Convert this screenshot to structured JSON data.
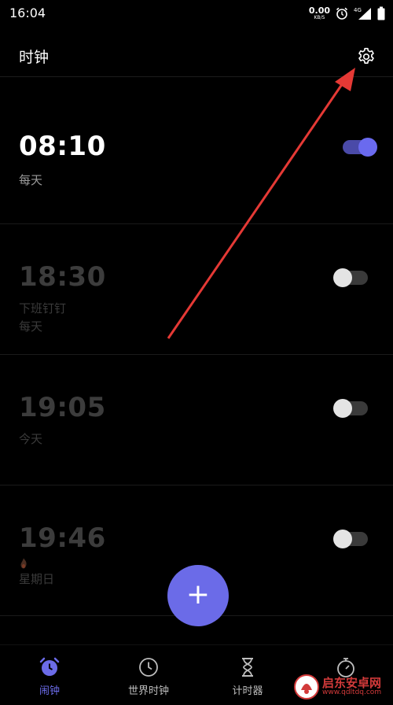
{
  "status_bar": {
    "time": "16:04",
    "net_speed": "0.00",
    "net_unit": "KB/S",
    "network": "4G",
    "icons": [
      "alarm-clock-icon",
      "signal-icon",
      "battery-icon"
    ]
  },
  "header": {
    "title": "时钟",
    "settings_icon": "gear-icon"
  },
  "alarms": [
    {
      "time": "08:10",
      "label": "",
      "repeat": "每天",
      "enabled": true
    },
    {
      "time": "18:30",
      "label": "下班钉钉",
      "repeat": "每天",
      "enabled": false
    },
    {
      "time": "19:05",
      "label": "",
      "repeat": "今天",
      "enabled": false
    },
    {
      "time": "19:46",
      "label": "",
      "repeat": "星期日",
      "enabled": false
    }
  ],
  "fab": {
    "label": "+"
  },
  "bottom_nav": [
    {
      "label": "闹钟",
      "icon": "alarm-clock-icon",
      "active": true
    },
    {
      "label": "世界时钟",
      "icon": "clock-icon",
      "active": false
    },
    {
      "label": "计时器",
      "icon": "hourglass-icon",
      "active": false
    },
    {
      "label": "",
      "icon": "stopwatch-icon",
      "active": false
    }
  ],
  "watermark": {
    "name": "启东安卓网",
    "url": "www.qdltdq.com"
  },
  "colors": {
    "accent": "#6b6be8",
    "annotation_arrow": "#e53935",
    "background": "#000000"
  }
}
